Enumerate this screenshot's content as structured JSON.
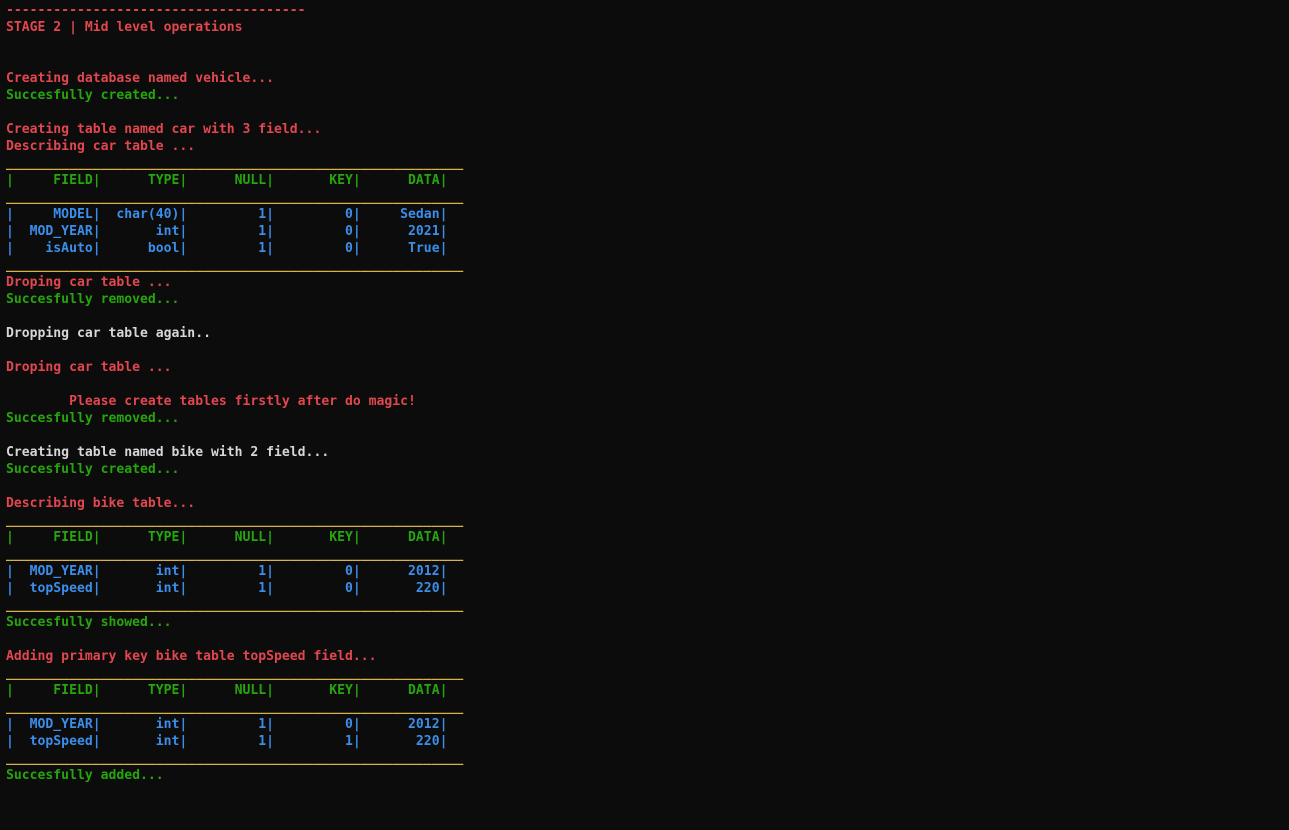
{
  "palette": {
    "background": "#0c0c0c",
    "red": "#e2474f",
    "green": "#26a50d",
    "white": "#d7d7d7",
    "yellow": "#d6b34b",
    "blue": "#3b8eea"
  },
  "lines": [
    {
      "text": "--------------------------------------",
      "color": "red"
    },
    {
      "text": "STAGE 2 | Mid level operations",
      "color": "red"
    },
    {
      "text": "",
      "color": "white"
    },
    {
      "text": "",
      "color": "white"
    },
    {
      "text": "Creating database named vehicle...",
      "color": "red"
    },
    {
      "text": "Succesfully created...",
      "color": "green"
    },
    {
      "text": "",
      "color": "white"
    },
    {
      "text": "Creating table named car with 3 field...",
      "color": "red"
    },
    {
      "text": "Describing car table ...",
      "color": "red"
    },
    {
      "text": "__________________________________________________________",
      "color": "yellow"
    },
    {
      "text": "|     FIELD|      TYPE|      NULL|       KEY|      DATA|",
      "color": "green"
    },
    {
      "text": "__________________________________________________________",
      "color": "yellow"
    },
    {
      "text": "|     MODEL|  char(40)|         1|         0|     Sedan|",
      "color": "blue"
    },
    {
      "text": "|  MOD_YEAR|       int|         1|         0|      2021|",
      "color": "blue"
    },
    {
      "text": "|    isAuto|      bool|         1|         0|      True|",
      "color": "blue"
    },
    {
      "text": "__________________________________________________________",
      "color": "yellow"
    },
    {
      "text": "Droping car table ...",
      "color": "red"
    },
    {
      "text": "Succesfully removed...",
      "color": "green"
    },
    {
      "text": "",
      "color": "white"
    },
    {
      "text": "Dropping car table again..",
      "color": "white"
    },
    {
      "text": "",
      "color": "white"
    },
    {
      "text": "Droping car table ...",
      "color": "red"
    },
    {
      "text": "",
      "color": "white"
    },
    {
      "text": "        Please create tables firstly after do magic!",
      "color": "red"
    },
    {
      "text": "Succesfully removed...",
      "color": "green"
    },
    {
      "text": "",
      "color": "white"
    },
    {
      "text": "Creating table named bike with 2 field...",
      "color": "white"
    },
    {
      "text": "Succesfully created...",
      "color": "green"
    },
    {
      "text": "",
      "color": "white"
    },
    {
      "text": "Describing bike table...",
      "color": "red"
    },
    {
      "text": "__________________________________________________________",
      "color": "yellow"
    },
    {
      "text": "|     FIELD|      TYPE|      NULL|       KEY|      DATA|",
      "color": "green"
    },
    {
      "text": "__________________________________________________________",
      "color": "yellow"
    },
    {
      "text": "|  MOD_YEAR|       int|         1|         0|      2012|",
      "color": "blue"
    },
    {
      "text": "|  topSpeed|       int|         1|         0|       220|",
      "color": "blue"
    },
    {
      "text": "__________________________________________________________",
      "color": "yellow"
    },
    {
      "text": "Succesfully showed...",
      "color": "green"
    },
    {
      "text": "",
      "color": "white"
    },
    {
      "text": "Adding primary key bike table topSpeed field...",
      "color": "red"
    },
    {
      "text": "__________________________________________________________",
      "color": "yellow"
    },
    {
      "text": "|     FIELD|      TYPE|      NULL|       KEY|      DATA|",
      "color": "green"
    },
    {
      "text": "__________________________________________________________",
      "color": "yellow"
    },
    {
      "text": "|  MOD_YEAR|       int|         1|         0|      2012|",
      "color": "blue"
    },
    {
      "text": "|  topSpeed|       int|         1|         1|       220|",
      "color": "blue"
    },
    {
      "text": "__________________________________________________________",
      "color": "yellow"
    },
    {
      "text": "Succesfully added...",
      "color": "green"
    }
  ]
}
